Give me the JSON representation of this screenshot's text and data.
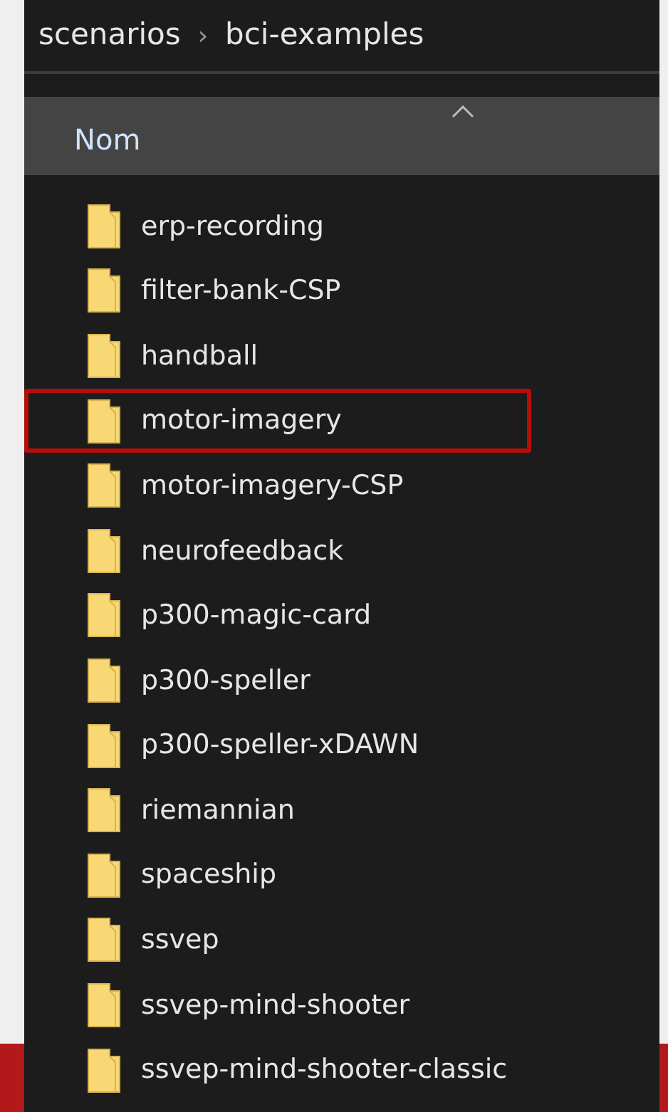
{
  "breadcrumb": [
    "scenarios",
    "bci-examples"
  ],
  "breadcrumb_separator": "›",
  "column_header": {
    "label": "Nom",
    "sorted_ascending": true
  },
  "items": [
    {
      "name": "erp-recording",
      "highlighted": false
    },
    {
      "name": "filter-bank-CSP",
      "highlighted": false
    },
    {
      "name": "handball",
      "highlighted": false
    },
    {
      "name": "motor-imagery",
      "highlighted": true
    },
    {
      "name": "motor-imagery-CSP",
      "highlighted": false
    },
    {
      "name": "neurofeedback",
      "highlighted": false
    },
    {
      "name": "p300-magic-card",
      "highlighted": false
    },
    {
      "name": "p300-speller",
      "highlighted": false
    },
    {
      "name": "p300-speller-xDAWN",
      "highlighted": false
    },
    {
      "name": "riemannian",
      "highlighted": false
    },
    {
      "name": "spaceship",
      "highlighted": false
    },
    {
      "name": "ssvep",
      "highlighted": false
    },
    {
      "name": "ssvep-mind-shooter",
      "highlighted": false
    },
    {
      "name": "ssvep-mind-shooter-classic",
      "highlighted": false
    }
  ]
}
